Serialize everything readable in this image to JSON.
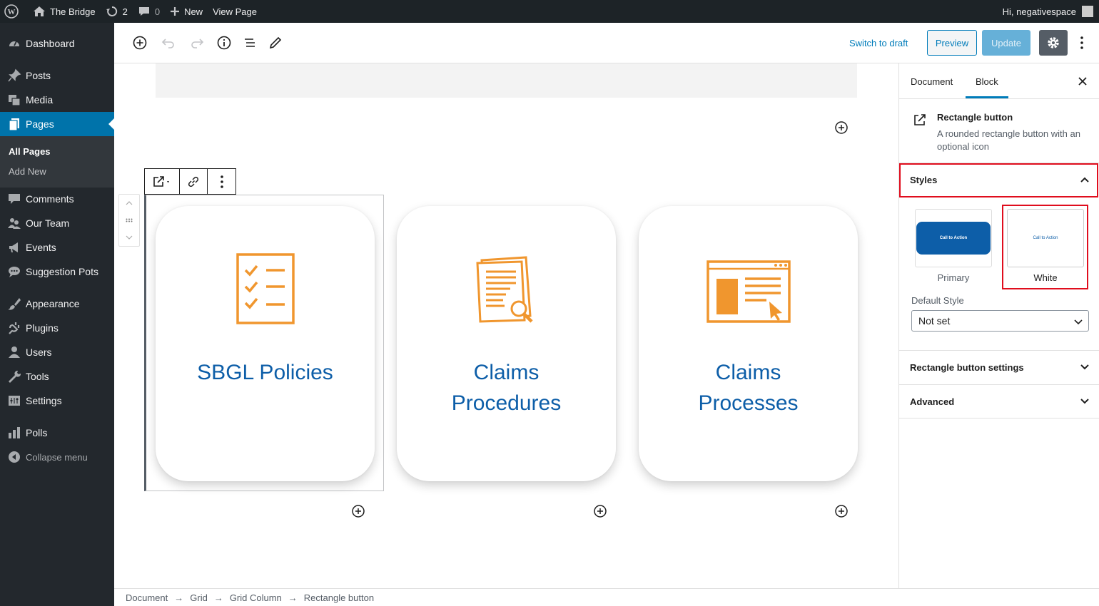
{
  "adminbar": {
    "site_name": "The Bridge",
    "updates_count": "2",
    "comments_count": "0",
    "new_label": "New",
    "view_page_label": "View Page",
    "greeting": "Hi, negativespace"
  },
  "sidebar": {
    "items": [
      {
        "label": "Dashboard",
        "icon": "dashboard-icon"
      },
      {
        "label": "Posts",
        "icon": "pin-icon"
      },
      {
        "label": "Media",
        "icon": "media-icon"
      },
      {
        "label": "Pages",
        "icon": "pages-icon"
      },
      {
        "label": "Comments",
        "icon": "comment-icon"
      },
      {
        "label": "Our Team",
        "icon": "team-icon"
      },
      {
        "label": "Events",
        "icon": "megaphone-icon"
      },
      {
        "label": "Suggestion Pots",
        "icon": "bubbles-icon"
      },
      {
        "label": "Appearance",
        "icon": "brush-icon"
      },
      {
        "label": "Plugins",
        "icon": "plugin-icon"
      },
      {
        "label": "Users",
        "icon": "user-icon"
      },
      {
        "label": "Tools",
        "icon": "wrench-icon"
      },
      {
        "label": "Settings",
        "icon": "settings-icon"
      },
      {
        "label": "Polls",
        "icon": "chart-icon"
      }
    ],
    "submenu": [
      "All Pages",
      "Add New"
    ],
    "collapse_label": "Collapse menu"
  },
  "toolbar": {
    "switch_to_draft": "Switch to draft",
    "preview": "Preview",
    "update": "Update"
  },
  "canvas": {
    "cards": [
      {
        "title": "SBGL Policies",
        "icon": "checklist-icon"
      },
      {
        "title": "Claims Procedures",
        "icon": "document-search-icon"
      },
      {
        "title": "Claims Processes",
        "icon": "browser-window-icon"
      }
    ]
  },
  "breadcrumb": [
    "Document",
    "Grid",
    "Grid Column",
    "Rectangle button"
  ],
  "breadcrumb_sep": "→",
  "inspector": {
    "tabs": [
      "Document",
      "Block"
    ],
    "active_tab": "Block",
    "block_title": "Rectangle button",
    "block_description": "A rounded rectangle button with an optional icon",
    "styles_label": "Styles",
    "styles": [
      {
        "label": "Primary",
        "preview_text": "Call to Action"
      },
      {
        "label": "White",
        "preview_text": "Call to Action"
      }
    ],
    "default_style_label": "Default Style",
    "default_style_value": "Not set",
    "panels": [
      "Rectangle button settings",
      "Advanced"
    ]
  },
  "colors": {
    "accent": "#007cba",
    "card_title": "#0d5ea8",
    "icon_orange": "#f0962e",
    "highlight_red": "#e00d1d"
  }
}
